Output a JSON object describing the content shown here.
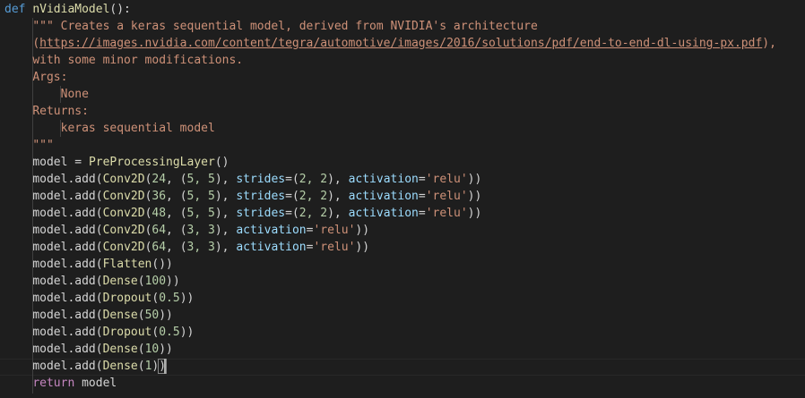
{
  "code": {
    "def_kw": "def",
    "function_name": "nVidiaModel",
    "def_tail": "():",
    "doc_line1": "\"\"\" Creates a keras sequential model, derived from NVIDIA's architecture",
    "doc_line2_open": "(",
    "doc_url": "https://images.nvidia.com/content/tegra/automotive/images/2016/solutions/pdf/end-to-end-dl-using-px.pdf",
    "doc_line2_close": "),",
    "doc_line3": "with some minor modifications.",
    "doc_args": "Args:",
    "doc_args_val": "None",
    "doc_returns": "Returns:",
    "doc_returns_val": "keras sequential model",
    "doc_close": "\"\"\"",
    "model_var": "model",
    "assign": " = ",
    "preproc_fn": "PreProcessingLayer",
    "call_empty": "()",
    "add_prefix": "model.add(",
    "conv_fn": "Conv2D",
    "flatten_fn": "Flatten",
    "dense_fn": "Dense",
    "dropout_fn": "Dropout",
    "strides_kw": "strides",
    "activation_kw": "activation",
    "relu_str": "'relu'",
    "return_kw": "return",
    "return_val": " model",
    "layers": [
      {
        "filters": "24",
        "kernel": "5, 5",
        "strides": "2, 2"
      },
      {
        "filters": "36",
        "kernel": "5, 5",
        "strides": "2, 2"
      },
      {
        "filters": "48",
        "kernel": "5, 5",
        "strides": "2, 2"
      },
      {
        "filters": "64",
        "kernel": "3, 3"
      },
      {
        "filters": "64",
        "kernel": "3, 3"
      }
    ],
    "dense_1": "100",
    "dropout_1": "0.5",
    "dense_2": "50",
    "dropout_2": "0.5",
    "dense_3": "10",
    "dense_4": "1"
  },
  "colors": {
    "background": "#1e1e1e",
    "keyword": "#569cd6",
    "control_keyword": "#c586c0",
    "function": "#dcdcaa",
    "parameter": "#9cdcfe",
    "number": "#b5cea8",
    "string": "#ce9178",
    "text": "#d4d4d4"
  }
}
